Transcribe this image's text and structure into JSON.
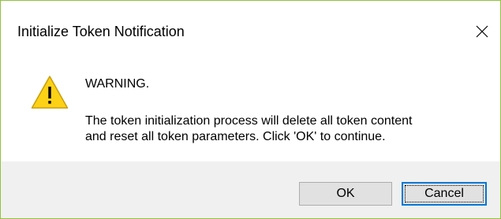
{
  "window": {
    "title": "Initialize Token Notification",
    "close_icon": "close-icon",
    "border_color": "#8fc33f"
  },
  "content": {
    "icon": "warning-icon",
    "heading": "WARNING.",
    "message_lines": [
      "The token initialization process will delete all token content",
      "and reset all token parameters. Click 'OK' to continue."
    ]
  },
  "buttons": {
    "ok_label": "OK",
    "cancel_label": "Cancel",
    "default_button_accent": "#0078d7"
  }
}
